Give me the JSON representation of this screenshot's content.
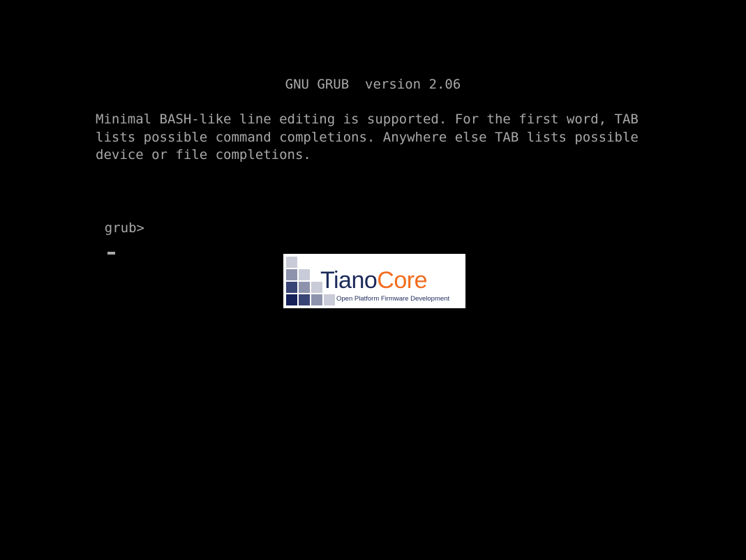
{
  "header": {
    "title": "GNU GRUB  version 2.06"
  },
  "help_text": {
    "lines": [
      "Minimal BASH-like line editing is supported. For the first word, TAB",
      "lists possible command completions. Anywhere else TAB lists possible",
      "device or file completions."
    ]
  },
  "console": {
    "prompt": "grub>",
    "input_value": ""
  },
  "logo": {
    "word_part1": "Tiano",
    "word_part2": "Core",
    "tagline": "Open Platform Firmware Development"
  },
  "colors": {
    "background": "#000000",
    "text": "#a8a8a8",
    "logo_navy": "#1c2a5a",
    "logo_orange": "#f26b1d"
  }
}
